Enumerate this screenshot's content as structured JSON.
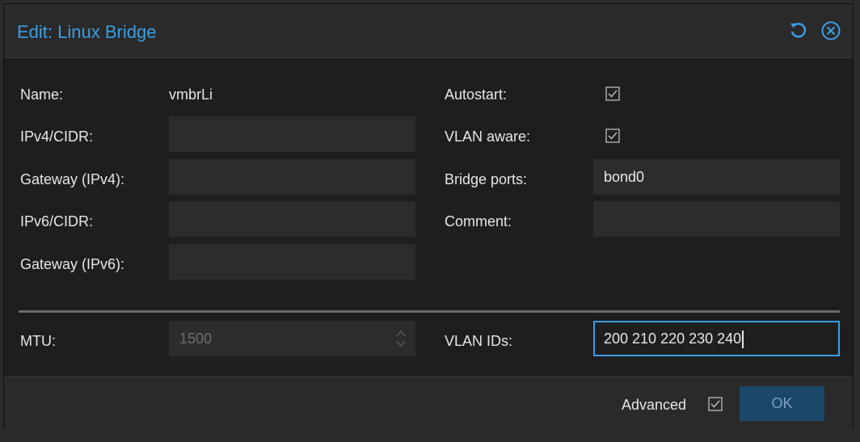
{
  "dialog": {
    "title": "Edit: Linux Bridge",
    "icons": {
      "reset": "reset-icon",
      "close": "close-icon"
    }
  },
  "form": {
    "name": {
      "label": "Name:",
      "value": "vmbrLi"
    },
    "ipv4_cidr": {
      "label": "IPv4/CIDR:",
      "value": ""
    },
    "gateway_ipv4": {
      "label": "Gateway (IPv4):",
      "value": ""
    },
    "ipv6_cidr": {
      "label": "IPv6/CIDR:",
      "value": ""
    },
    "gateway_ipv6": {
      "label": "Gateway (IPv6):",
      "value": ""
    },
    "autostart": {
      "label": "Autostart:",
      "checked": true
    },
    "vlan_aware": {
      "label": "VLAN aware:",
      "checked": true
    },
    "bridge_ports": {
      "label": "Bridge ports:",
      "value": "bond0"
    },
    "comment": {
      "label": "Comment:",
      "value": ""
    },
    "mtu": {
      "label": "MTU:",
      "placeholder": "1500"
    },
    "vlan_ids": {
      "label": "VLAN IDs:",
      "value": "200 210 220 230 240"
    }
  },
  "footer": {
    "advanced_label": "Advanced",
    "advanced_checked": true,
    "ok_label": "OK"
  },
  "colors": {
    "accent": "#3a9ee4",
    "focus_border": "#3a9ee4",
    "ok_bg": "#1b4868"
  }
}
